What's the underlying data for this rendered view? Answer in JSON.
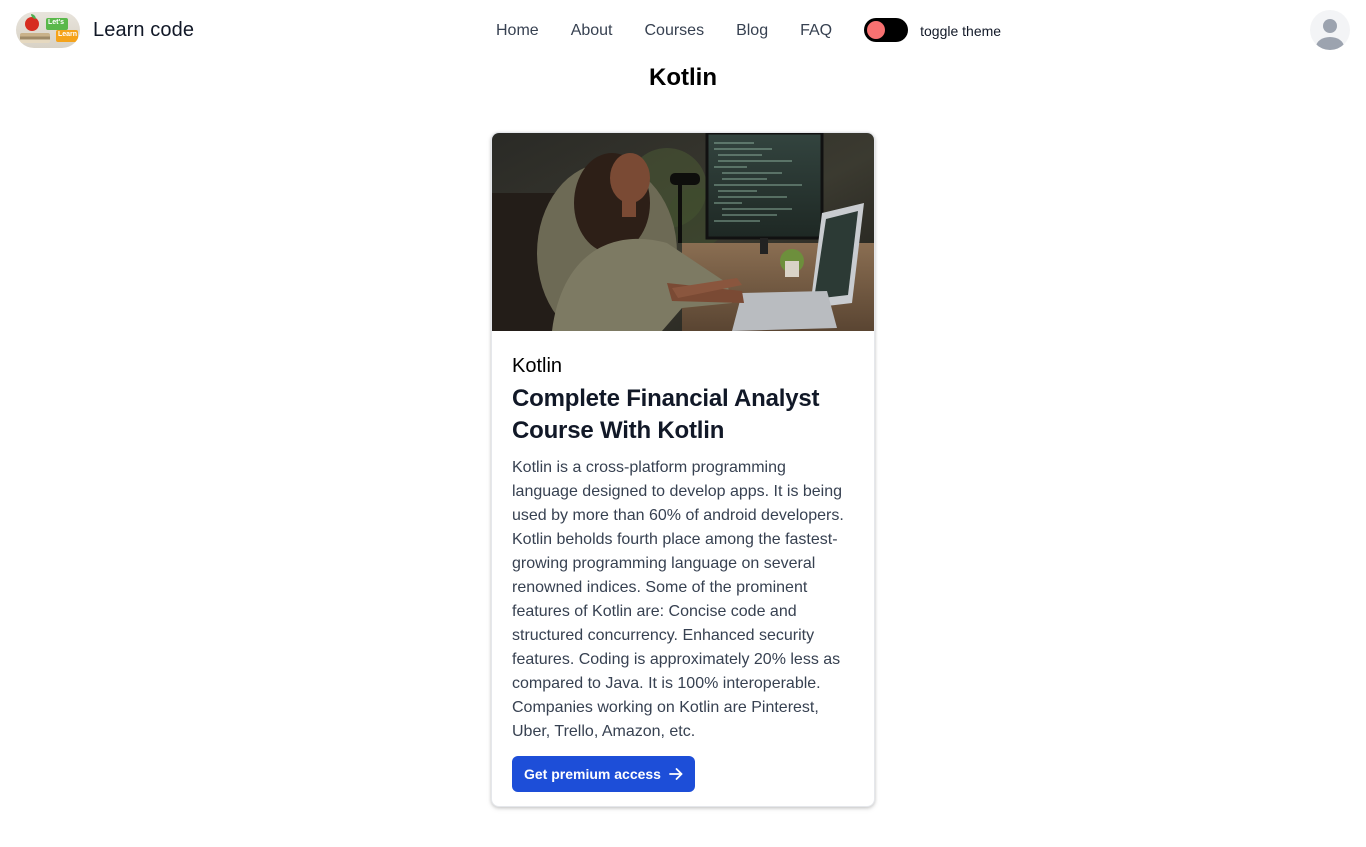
{
  "brand": {
    "name": "Learn code",
    "logo_text_top": "Let's",
    "logo_text_bottom": "Learn"
  },
  "nav": {
    "links": [
      "Home",
      "About",
      "Courses",
      "Blog",
      "FAQ"
    ],
    "toggle_label": "toggle theme"
  },
  "page": {
    "title": "Kotlin"
  },
  "card": {
    "tag": "Kotlin",
    "title": "Complete Financial Analyst Course With Kotlin",
    "description": "Kotlin is a cross-platform programming language designed to develop apps. It is being used by more than 60% of android developers. Kotlin beholds fourth place among the fastest-growing programming language on several renowned indices. Some of the prominent features of Kotlin are: Concise code and structured concurrency. Enhanced security features. Coding is approximately 20% less as compared to Java. It is 100% interoperable. Companies working on Kotlin are Pinterest, Uber, Trello, Amazon, etc.",
    "cta_label": "Get premium access"
  },
  "colors": {
    "accent": "#1d4ed8",
    "toggle_knob": "#f87171",
    "toggle_track": "#000000"
  },
  "icons": {
    "avatar": "user-avatar-icon",
    "cta_arrow": "arrow-right-icon"
  }
}
